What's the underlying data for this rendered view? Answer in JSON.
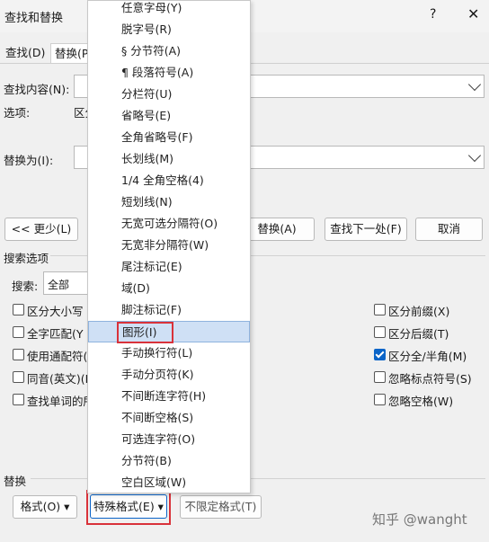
{
  "dialog": {
    "title": "查找和替换",
    "help": "?",
    "close": "✕"
  },
  "tabs": [
    {
      "label": "查找(D)"
    },
    {
      "label": "替换(P"
    }
  ],
  "find": {
    "label": "查找内容(N):",
    "options_label": "选项:",
    "options_value": "区分"
  },
  "replace": {
    "label": "替换为(I):"
  },
  "buttons": {
    "less": "<< 更少(L)",
    "replace_all": "替换(A)",
    "find_next": "查找下一处(F)",
    "cancel": "取消"
  },
  "search_options": {
    "heading": "搜索选项",
    "search_label": "搜索:",
    "search_value": "全部"
  },
  "checkboxes_left": [
    {
      "label": "区分大小写"
    },
    {
      "label": "全字匹配(Y"
    },
    {
      "label": "使用通配符("
    },
    {
      "label": "同音(英文)(K"
    },
    {
      "label": "查找单词的所"
    }
  ],
  "checkboxes_right": [
    {
      "label": "区分前缀(X)",
      "checked": false
    },
    {
      "label": "区分后缀(T)",
      "checked": false
    },
    {
      "label": "区分全/半角(M)",
      "checked": true
    },
    {
      "label": "忽略标点符号(S)",
      "checked": false
    },
    {
      "label": "忽略空格(W)",
      "checked": false
    }
  ],
  "footer": {
    "section": "替换",
    "format": "格式(O) ▾",
    "special": "特殊格式(E) ▾",
    "no_format": "不限定格式(T)"
  },
  "menu": {
    "items": [
      "任意字母(Y)",
      "脱字号(R)",
      "§ 分节符(A)",
      "¶ 段落符号(A)",
      "分栏符(U)",
      "省略号(E)",
      "全角省略号(F)",
      "长划线(M)",
      "1/4 全角空格(4)",
      "短划线(N)",
      "无宽可选分隔符(O)",
      "无宽非分隔符(W)",
      "尾注标记(E)",
      "域(D)",
      "脚注标记(F)",
      "图形(I)",
      "手动换行符(L)",
      "手动分页符(K)",
      "不间断连字符(H)",
      "不间断空格(S)",
      "可选连字符(O)",
      "分节符(B)",
      "空白区域(W)"
    ],
    "highlighted_index": 15
  },
  "watermark": "知乎 @wanght",
  "colors": {
    "accent": "#0a64c8",
    "highlight": "#cfe0f5",
    "annotation": "#d9323a"
  }
}
